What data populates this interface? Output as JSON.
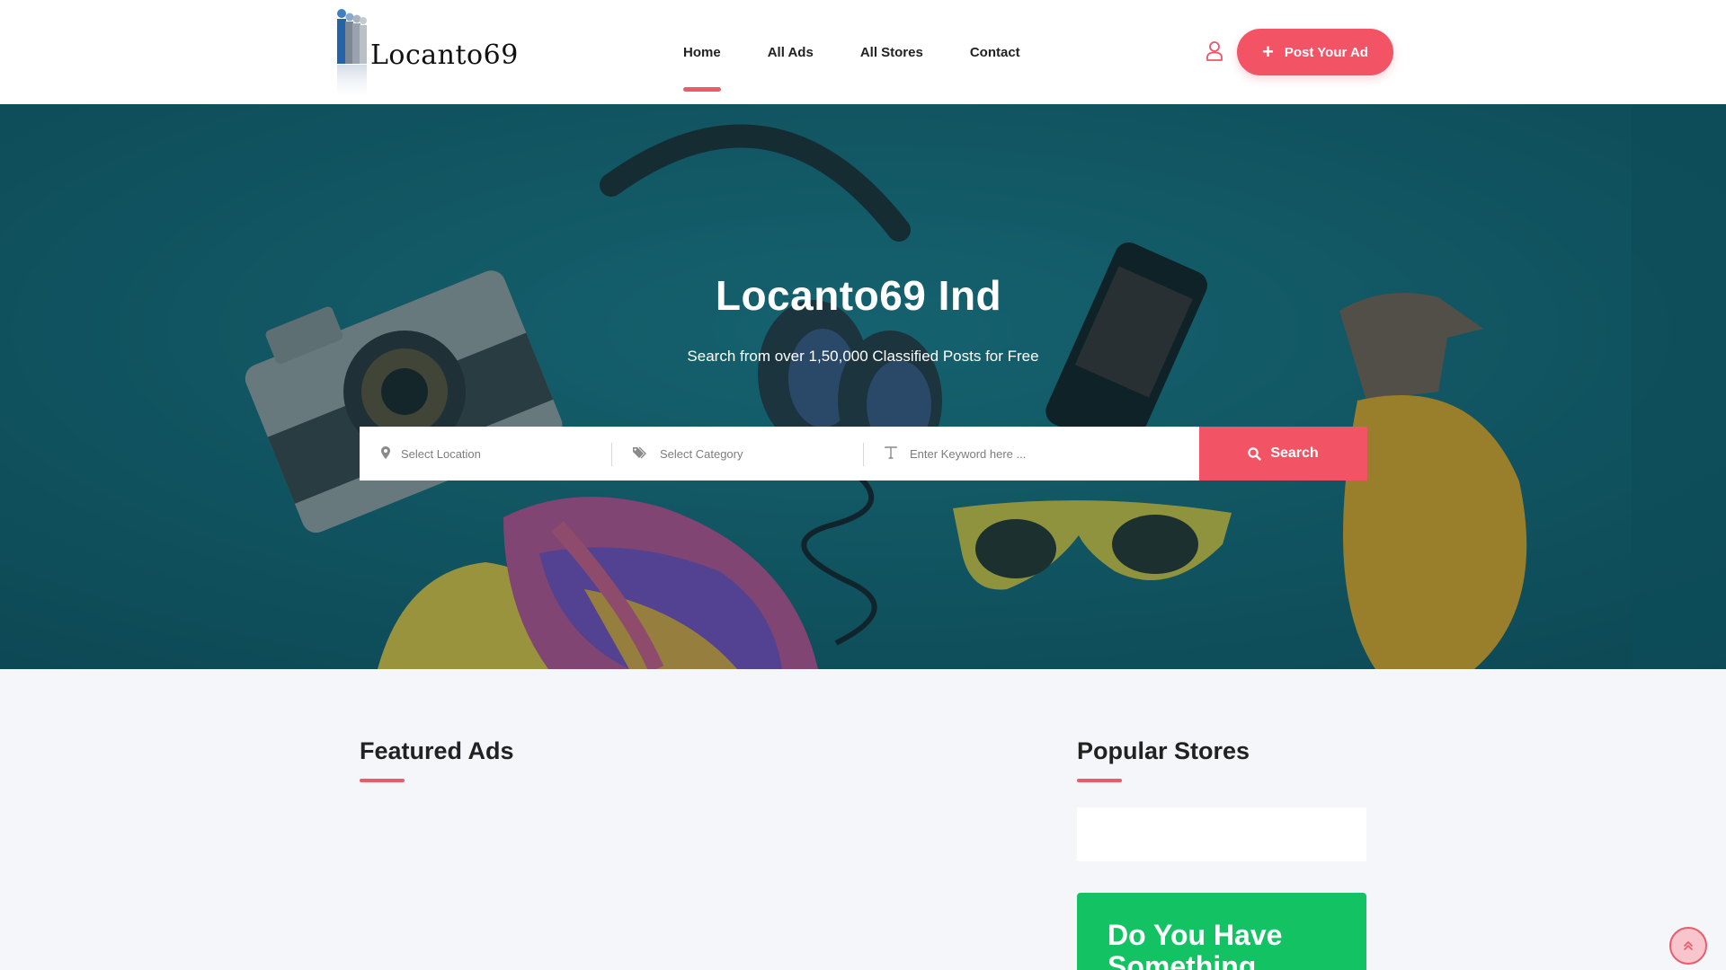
{
  "brand": {
    "name": "Locanto69",
    "logo_alt": "Locanto69 logo"
  },
  "nav": {
    "items": [
      {
        "label": "Home",
        "active": true
      },
      {
        "label": "All Ads",
        "active": false
      },
      {
        "label": "All Stores",
        "active": false
      },
      {
        "label": "Contact",
        "active": false
      }
    ],
    "user_icon": "user-icon",
    "post_ad_label": "Post Your Ad"
  },
  "hero": {
    "title": "Locanto69 Ind",
    "subtitle": "Search from over 1,50,000 Classified Posts for Free"
  },
  "search": {
    "location_placeholder": "Select Location",
    "category_placeholder": "Select Category",
    "keyword_placeholder": "Enter Keyword here ...",
    "button_label": "Search"
  },
  "sections": {
    "featured_title": "Featured Ads",
    "popular_title": "Popular Stores",
    "cta_text": "Do You Have Something"
  },
  "colors": {
    "accent": "#f25466",
    "cta_green": "#13c262",
    "page_bg": "#f5f6fa",
    "hero_teal": "#145d6a"
  }
}
